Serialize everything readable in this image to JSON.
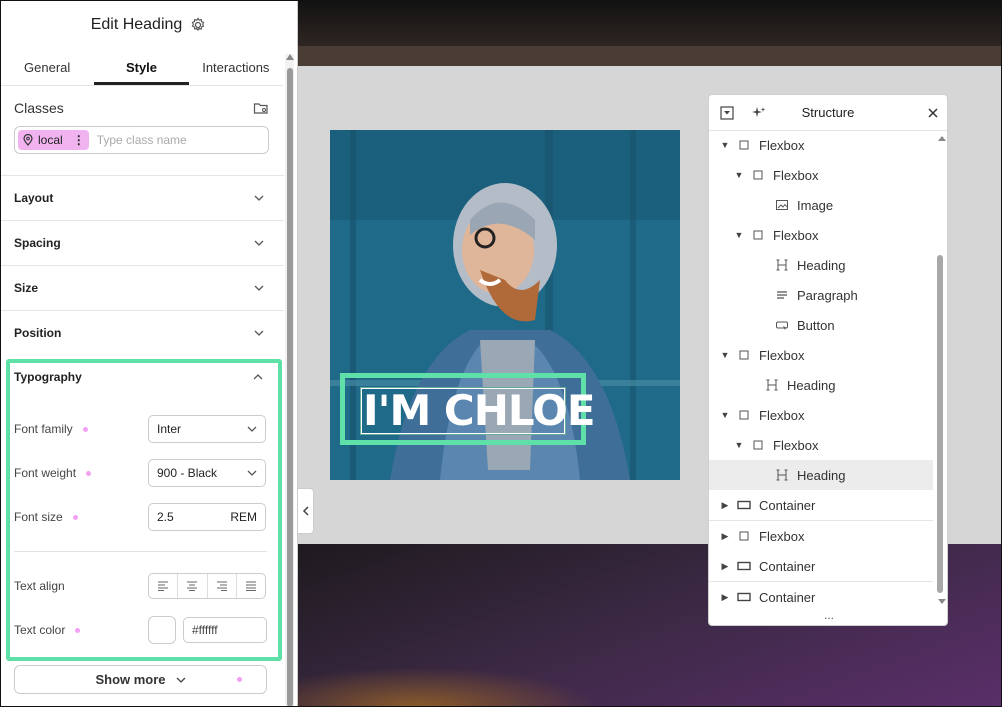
{
  "panel": {
    "title": "Edit Heading",
    "tabs": [
      "General",
      "Style",
      "Interactions"
    ],
    "active_tab": "Style",
    "classes_label": "Classes",
    "class_chip": "local",
    "class_placeholder": "Type class name",
    "sections": [
      "Layout",
      "Spacing",
      "Size",
      "Position"
    ],
    "typography": {
      "title": "Typography",
      "font_family_label": "Font family",
      "font_family_value": "Inter",
      "font_weight_label": "Font weight",
      "font_weight_value": "900 - Black",
      "font_size_label": "Font size",
      "font_size_value": "2.5",
      "font_size_unit": "REM",
      "text_align_label": "Text align",
      "text_color_label": "Text color",
      "text_color_value": "#ffffff"
    },
    "show_more": "Show more"
  },
  "canvas": {
    "heading_text": "I'M CHLOE"
  },
  "structure": {
    "title": "Structure",
    "items": [
      {
        "label": "Flexbox",
        "icon": "box-icon",
        "caret": "down"
      },
      {
        "label": "Flexbox",
        "icon": "box-icon",
        "caret": "down"
      },
      {
        "label": "Image",
        "icon": "image-icon",
        "caret": ""
      },
      {
        "label": "Flexbox",
        "icon": "box-icon",
        "caret": "down"
      },
      {
        "label": "Heading",
        "icon": "heading-icon",
        "caret": ""
      },
      {
        "label": "Paragraph",
        "icon": "paragraph-icon",
        "caret": ""
      },
      {
        "label": "Button",
        "icon": "button-icon",
        "caret": ""
      },
      {
        "label": "Flexbox",
        "icon": "box-icon",
        "caret": "down"
      },
      {
        "label": "Heading",
        "icon": "heading-icon",
        "caret": ""
      },
      {
        "label": "Flexbox",
        "icon": "box-icon",
        "caret": "down"
      },
      {
        "label": "Flexbox",
        "icon": "box-icon",
        "caret": "down"
      },
      {
        "label": "Heading",
        "icon": "heading-icon",
        "caret": "",
        "selected": true
      },
      {
        "label": "Container",
        "icon": "container-icon",
        "caret": "right"
      },
      {
        "label": "Flexbox",
        "icon": "box-icon",
        "caret": "right"
      },
      {
        "label": "Container",
        "icon": "container-icon",
        "caret": "right"
      },
      {
        "label": "Container",
        "icon": "container-icon",
        "caret": "right"
      }
    ],
    "footer": "..."
  },
  "colors": {
    "accent_outline": "#5fe0a8",
    "chip_bg": "#f0b3f0"
  }
}
